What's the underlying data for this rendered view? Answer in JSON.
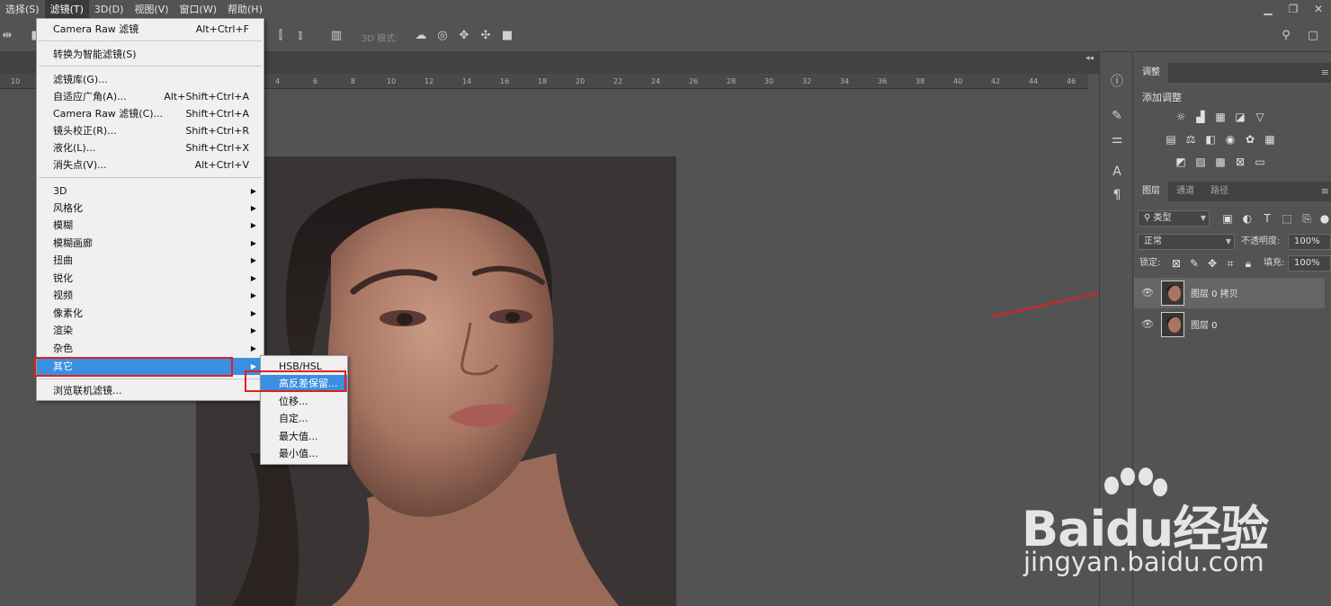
{
  "menubar": {
    "items": [
      {
        "label": "选择(S)",
        "active": false
      },
      {
        "label": "滤镜(T)",
        "active": true
      },
      {
        "label": "3D(D)",
        "active": false
      },
      {
        "label": "视图(V)",
        "active": false
      },
      {
        "label": "窗口(W)",
        "active": false
      },
      {
        "label": "帮助(H)",
        "active": false
      }
    ]
  },
  "options_bar": {
    "mode_3d_label": "3D 模式:"
  },
  "ruler": {
    "ticks": [
      "10",
      "4",
      "6",
      "8",
      "10",
      "12",
      "14",
      "16",
      "18",
      "20",
      "22",
      "24",
      "26",
      "28",
      "30",
      "32",
      "34",
      "36",
      "38",
      "40",
      "42",
      "44",
      "46"
    ]
  },
  "filter_menu": {
    "items": [
      {
        "label": "Camera Raw 滤镜",
        "shortcut": "Alt+Ctrl+F"
      },
      {
        "label": "转换为智能滤镜(S)",
        "shortcut": ""
      },
      {
        "label": "滤镜库(G)...",
        "shortcut": ""
      },
      {
        "label": "自适应广角(A)...",
        "shortcut": "Alt+Shift+Ctrl+A"
      },
      {
        "label": "Camera Raw 滤镜(C)...",
        "shortcut": "Shift+Ctrl+A"
      },
      {
        "label": "镜头校正(R)...",
        "shortcut": "Shift+Ctrl+R"
      },
      {
        "label": "液化(L)...",
        "shortcut": "Shift+Ctrl+X"
      },
      {
        "label": "消失点(V)...",
        "shortcut": "Alt+Ctrl+V"
      },
      {
        "label": "3D",
        "submenu": true
      },
      {
        "label": "风格化",
        "submenu": true
      },
      {
        "label": "模糊",
        "submenu": true
      },
      {
        "label": "模糊画廊",
        "submenu": true
      },
      {
        "label": "扭曲",
        "submenu": true
      },
      {
        "label": "锐化",
        "submenu": true
      },
      {
        "label": "视频",
        "submenu": true
      },
      {
        "label": "像素化",
        "submenu": true
      },
      {
        "label": "渲染",
        "submenu": true
      },
      {
        "label": "杂色",
        "submenu": true
      },
      {
        "label": "其它",
        "submenu": true,
        "highlighted": true
      },
      {
        "label": "浏览联机滤镜...",
        "shortcut": ""
      }
    ]
  },
  "other_submenu": {
    "items": [
      {
        "label": "HSB/HSL"
      },
      {
        "label": "高反差保留...",
        "highlighted": true
      },
      {
        "label": "位移..."
      },
      {
        "label": "自定..."
      },
      {
        "label": "最大值..."
      },
      {
        "label": "最小值..."
      }
    ]
  },
  "adjustments_panel": {
    "tab": "调整",
    "title": "添加调整"
  },
  "layers_panel": {
    "tabs": [
      "图层",
      "通道",
      "路径"
    ],
    "filter_kind": "类型",
    "blend_mode": "正常",
    "opacity_label": "不透明度:",
    "opacity_value": "100%",
    "lock_label": "锁定:",
    "fill_label": "填充:",
    "fill_value": "100%",
    "layers": [
      {
        "name": "图层 0 拷贝",
        "selected": true
      },
      {
        "name": "图层 0",
        "selected": false
      }
    ]
  },
  "watermark": {
    "logo": "Baidu经验",
    "url": "jingyan.baidu.com"
  },
  "colors": {
    "ui_gray": "#535353",
    "menu_bg": "#f0f0f0",
    "highlight": "#3b8fe0",
    "annotation_red": "#e02020"
  }
}
